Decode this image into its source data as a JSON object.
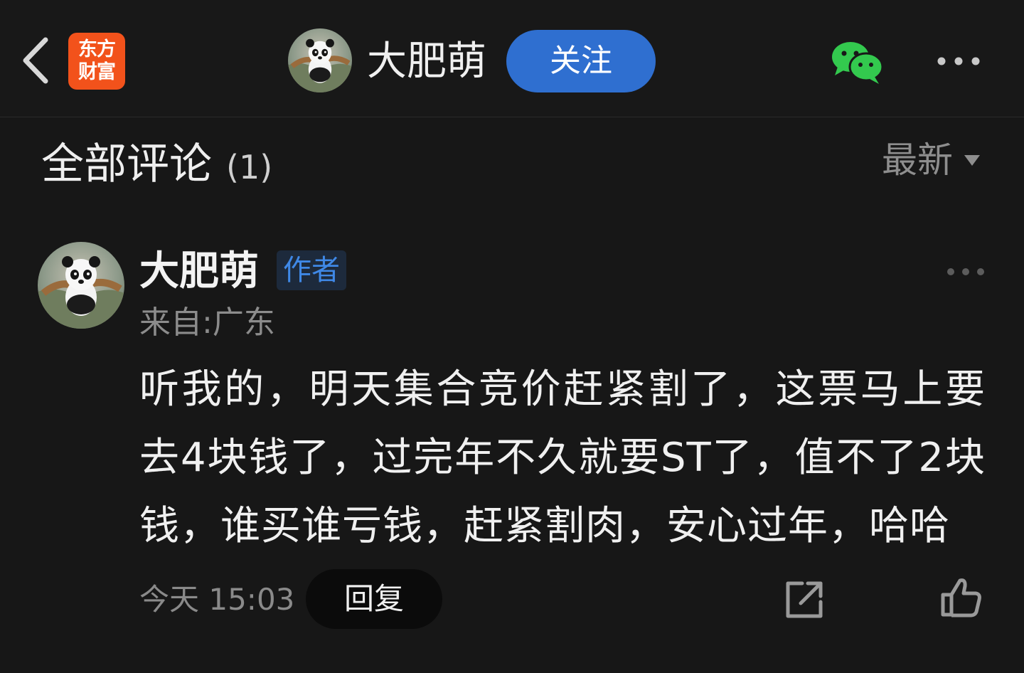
{
  "header": {
    "back_icon": "chevron-left-icon",
    "logo_line1": "东方",
    "logo_line2": "财富",
    "author_name": "大肥萌",
    "follow_label": "关注",
    "share_wechat_icon": "wechat-icon",
    "more_icon": "more-horizontal-icon",
    "colors": {
      "follow_button": "#2f6fd0",
      "logo": "#f2521b",
      "wechat": "#33c94e"
    }
  },
  "comments_section": {
    "title": "全部评论",
    "count": "(1)",
    "sort_label": "最新",
    "sort_icon": "caret-down-icon"
  },
  "comments": [
    {
      "author": "大肥萌",
      "badge": "作者",
      "location": "来自:广东",
      "text": "听我的，明天集合竞价赶紧割了，这票马上要去4块钱了，过完年不久就要ST了，值不了2块钱，谁买谁亏钱，赶紧割肉，安心过年，哈哈",
      "time": "今天 15:03",
      "reply_label": "回复",
      "share_icon": "share-icon",
      "like_icon": "thumbs-up-icon",
      "more_icon": "more-horizontal-icon"
    }
  ]
}
